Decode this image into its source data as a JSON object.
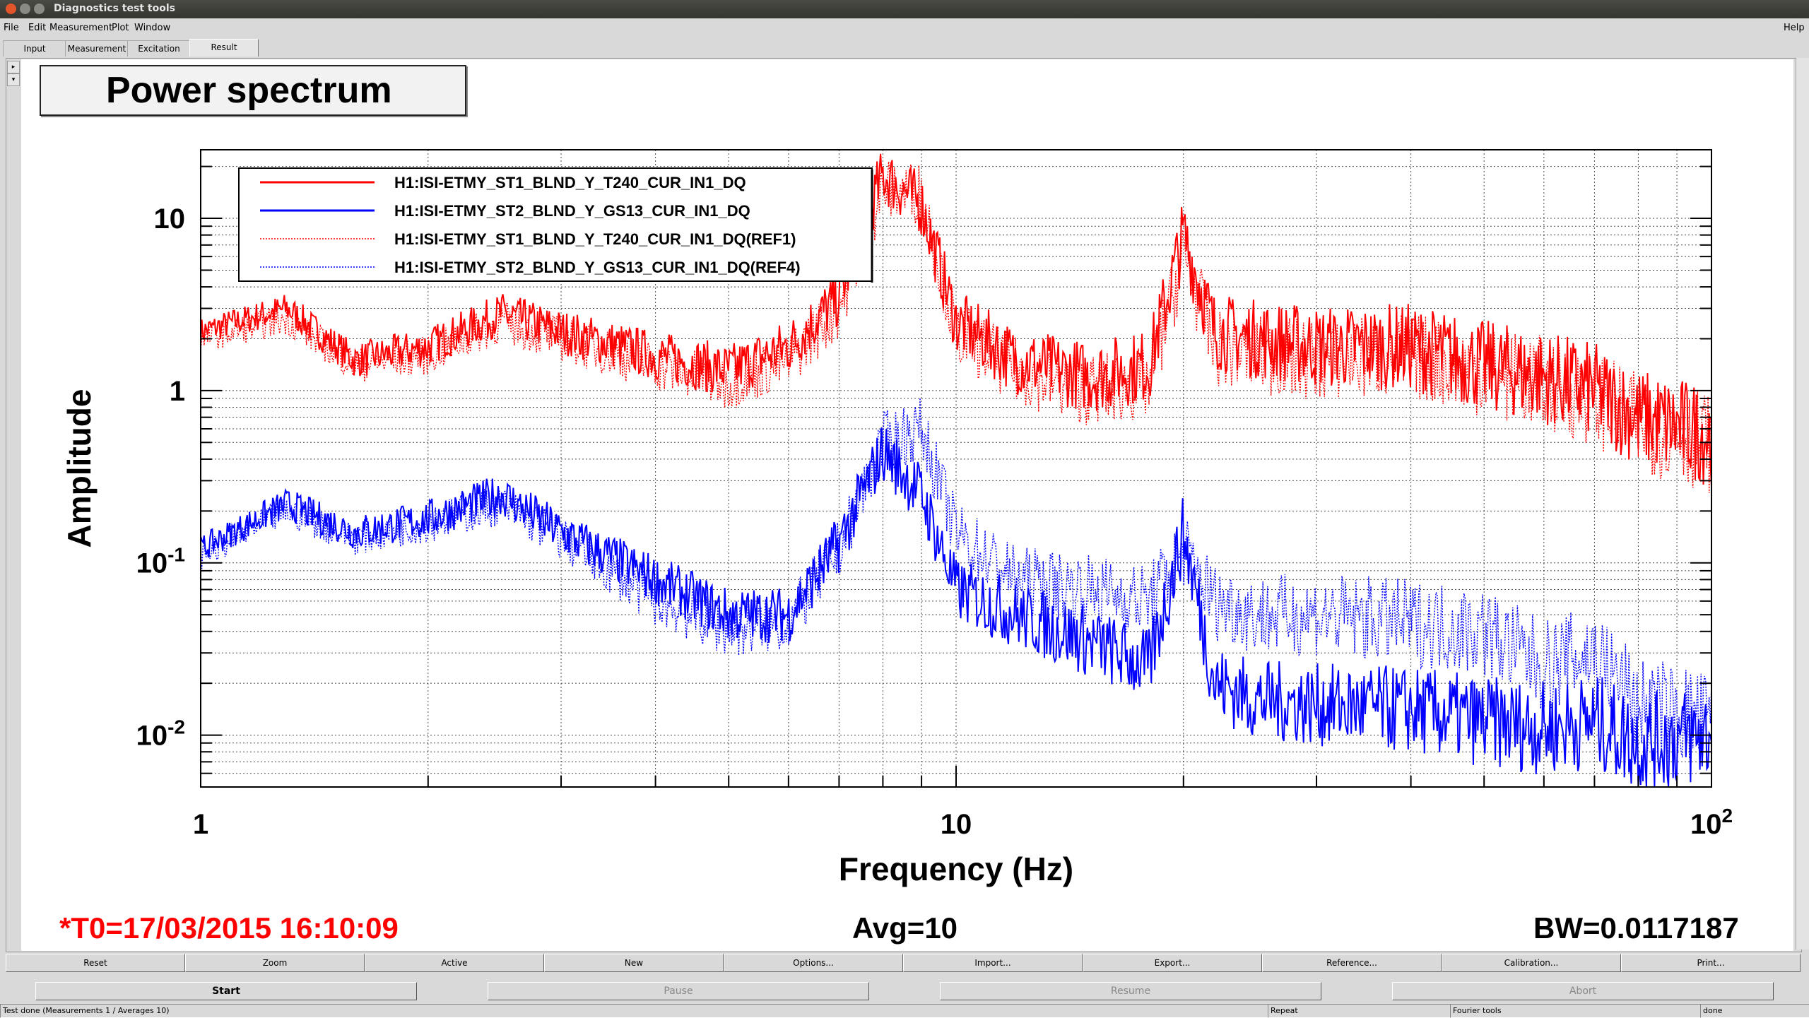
{
  "window": {
    "title": "Diagnostics test tools"
  },
  "menu": [
    {
      "label": "File"
    },
    {
      "label": "Edit"
    },
    {
      "label": "Measurement"
    },
    {
      "label": "Plot"
    },
    {
      "label": "Window"
    }
  ],
  "menu_help": "Help",
  "tabs": [
    "Input",
    "Measurement",
    "Excitation",
    "Result"
  ],
  "active_tab": "Result",
  "plot": {
    "title": "Power spectrum",
    "t0": "*T0=17/03/2015 16:10:09",
    "avg": "Avg=10",
    "bw": "BW=0.0117187"
  },
  "colors": {
    "red": "#ff0000",
    "blue": "#0000ff",
    "footer_red": "#ff0000"
  },
  "chart_data": {
    "type": "line",
    "title": "Power spectrum",
    "xlabel": "Frequency (Hz)",
    "ylabel": "Amplitude",
    "x_scale": "log",
    "y_scale": "log",
    "xlim": [
      1,
      100
    ],
    "ylim": [
      0.005,
      25
    ],
    "x_ticks": [
      "1",
      "10",
      "10^2"
    ],
    "y_ticks": [
      "10^-2",
      "10^-1",
      "1",
      "10"
    ],
    "grid": true,
    "legend_position": "top-left",
    "series": [
      {
        "name": "H1:ISI-ETMY_ST1_BLND_Y_T240_CUR_IN1_DQ",
        "style": "solid",
        "color": "#ff0000",
        "x": [
          1,
          1.3,
          1.6,
          2,
          2.5,
          3,
          4,
          5,
          6,
          7,
          8,
          9,
          10,
          12,
          15,
          18,
          20,
          22,
          25,
          30,
          40,
          50,
          60,
          70,
          80,
          100
        ],
        "y": [
          2.2,
          3.0,
          1.5,
          1.8,
          2.8,
          2.2,
          1.6,
          1.3,
          1.8,
          3.5,
          18,
          12,
          2.5,
          1.5,
          1.2,
          1.4,
          8,
          2.2,
          2.0,
          1.8,
          1.8,
          1.4,
          1.2,
          1.0,
          0.7,
          0.55
        ]
      },
      {
        "name": "H1:ISI-ETMY_ST2_BLND_Y_GS13_CUR_IN1_DQ",
        "style": "solid",
        "color": "#0000ff",
        "x": [
          1,
          1.3,
          1.6,
          2,
          2.5,
          3,
          4,
          5,
          6,
          7,
          8,
          9,
          10,
          12,
          15,
          18,
          20,
          22,
          25,
          30,
          40,
          50,
          60,
          70,
          80,
          100
        ],
        "y": [
          0.12,
          0.22,
          0.15,
          0.18,
          0.25,
          0.15,
          0.08,
          0.05,
          0.05,
          0.13,
          0.45,
          0.25,
          0.07,
          0.05,
          0.035,
          0.025,
          0.15,
          0.02,
          0.016,
          0.015,
          0.014,
          0.012,
          0.011,
          0.012,
          0.009,
          0.01
        ]
      },
      {
        "name": "H1:ISI-ETMY_ST1_BLND_Y_T240_CUR_IN1_DQ(REF1)",
        "style": "dotted",
        "color": "#ff0000",
        "x": [
          1,
          1.3,
          1.6,
          2,
          2.5,
          3,
          4,
          5,
          6,
          7,
          8,
          9,
          10,
          12,
          15,
          18,
          20,
          22,
          25,
          30,
          40,
          50,
          60,
          70,
          80,
          100
        ],
        "y": [
          2.0,
          2.6,
          1.4,
          1.6,
          2.5,
          2.0,
          1.4,
          1.1,
          1.5,
          3.0,
          15,
          14,
          2.2,
          1.3,
          1.0,
          1.1,
          6,
          1.8,
          1.6,
          1.5,
          1.6,
          1.3,
          1.1,
          0.9,
          0.65,
          0.5
        ]
      },
      {
        "name": "H1:ISI-ETMY_ST2_BLND_Y_GS13_CUR_IN1_DQ(REF4)",
        "style": "dotted",
        "color": "#0000ff",
        "x": [
          1,
          1.3,
          1.6,
          2,
          2.5,
          3,
          4,
          5,
          6,
          7,
          8,
          9,
          10,
          12,
          15,
          18,
          20,
          22,
          25,
          30,
          40,
          50,
          60,
          70,
          80,
          100
        ],
        "y": [
          0.11,
          0.2,
          0.14,
          0.17,
          0.22,
          0.14,
          0.06,
          0.04,
          0.045,
          0.12,
          0.5,
          0.6,
          0.15,
          0.08,
          0.07,
          0.06,
          0.12,
          0.06,
          0.05,
          0.05,
          0.045,
          0.04,
          0.025,
          0.03,
          0.015,
          0.012
        ]
      }
    ]
  },
  "buttons_row1": [
    "Reset",
    "Zoom",
    "Active",
    "New",
    "Options...",
    "Import...",
    "Export...",
    "Reference...",
    "Calibration...",
    "Print..."
  ],
  "buttons_row2": [
    {
      "label": "Start",
      "enabled": true
    },
    {
      "label": "Pause",
      "enabled": false
    },
    {
      "label": "Resume",
      "enabled": false
    },
    {
      "label": "Abort",
      "enabled": false
    }
  ],
  "status": [
    "Test done (Measurements 1 / Averages 10)",
    "Repeat",
    "Fourier tools",
    "done"
  ]
}
